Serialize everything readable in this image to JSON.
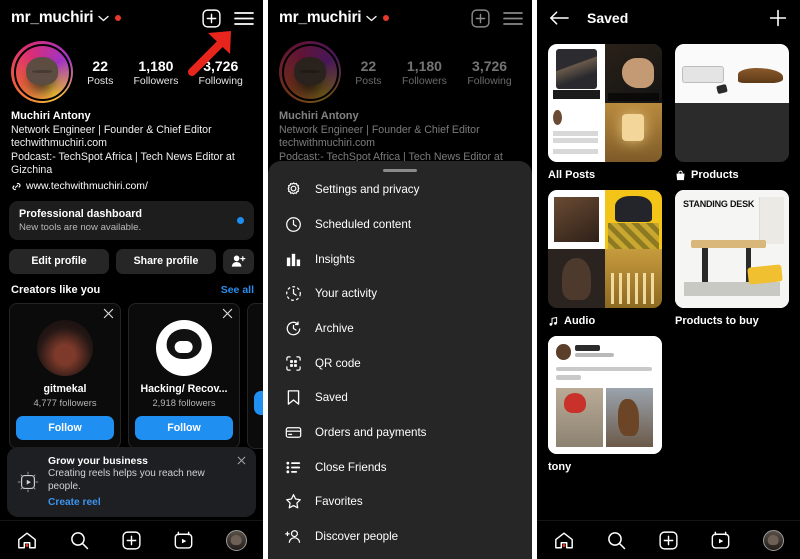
{
  "colors": {
    "accent_blue": "#1f8ff2",
    "link_blue": "#2d8ced",
    "arrow_red": "#e8251c",
    "notif_red": "#e8392a",
    "sheet_bg": "#262626",
    "panel_bg": "#000000"
  },
  "profile": {
    "username": "mr_muchiri",
    "stats": [
      {
        "value": "22",
        "label": "Posts"
      },
      {
        "value": "1,180",
        "label": "Followers"
      },
      {
        "value": "3,726",
        "label": "Following"
      }
    ],
    "display_name": "Muchiri Antony",
    "bio_lines": [
      "Network Engineer | Founder & Chief Editor",
      "techwithmuchiri.com",
      "Podcast:- TechSpot Africa | Tech News Editor at",
      "Gizchina"
    ],
    "bio_lines_panel2": [
      "Network Engineer | Founder & Chief Editor",
      "techwithmuchiri.com",
      "Podcast:- TechSpot Africa | Tech News Editor at"
    ],
    "link": "www.techwithmuchiri.com/",
    "dashboard": {
      "title": "Professional dashboard",
      "subtitle": "New tools are now available."
    },
    "buttons": {
      "edit": "Edit profile",
      "share": "Share profile"
    },
    "creators": {
      "title": "Creators like you",
      "see_all": "See all"
    },
    "creator_cards": [
      {
        "name": "gitmekal",
        "followers": "4,777 followers",
        "follow": "Follow"
      },
      {
        "name": "Hacking/ Recov...",
        "followers": "2,918 followers",
        "follow": "Follow"
      },
      {
        "name": "",
        "followers": "",
        "follow": ""
      }
    ],
    "toast": {
      "title": "Grow your business",
      "body": "Creating reels helps you reach new people.",
      "link": "Create reel"
    }
  },
  "menu": {
    "items": [
      {
        "icon": "gear-icon",
        "label": "Settings and privacy"
      },
      {
        "icon": "clock-icon",
        "label": "Scheduled content"
      },
      {
        "icon": "insights-bars-icon",
        "label": "Insights"
      },
      {
        "icon": "activity-clock-icon",
        "label": "Your activity"
      },
      {
        "icon": "archive-icon",
        "label": "Archive"
      },
      {
        "icon": "qr-code-icon",
        "label": "QR code"
      },
      {
        "icon": "bookmark-icon",
        "label": "Saved"
      },
      {
        "icon": "card-icon",
        "label": "Orders and payments"
      },
      {
        "icon": "list-icon",
        "label": "Close Friends"
      },
      {
        "icon": "star-icon",
        "label": "Favorites"
      },
      {
        "icon": "add-person-icon",
        "label": "Discover people"
      }
    ]
  },
  "saved": {
    "title": "Saved",
    "collections": [
      {
        "label": "All Posts",
        "icon": ""
      },
      {
        "label": "Products",
        "icon": "bag-icon"
      },
      {
        "label": "Audio",
        "icon": "music-note-icon"
      },
      {
        "label": "Products to buy",
        "icon": ""
      },
      {
        "label": "tony",
        "icon": ""
      }
    ],
    "standing_desk_label": "STANDING DESK"
  },
  "bottom_nav": [
    {
      "icon": "home-icon",
      "label": "Home"
    },
    {
      "icon": "search-icon",
      "label": "Search"
    },
    {
      "icon": "add-post-icon",
      "label": "Create"
    },
    {
      "icon": "reels-icon",
      "label": "Reels"
    },
    {
      "icon": "profile-avatar",
      "label": "Profile"
    }
  ],
  "annotations": [
    {
      "name": "arrow-to-menu",
      "target": "hamburger-menu"
    },
    {
      "name": "arrow-to-saved",
      "target": "menu-item-saved"
    },
    {
      "name": "arrow-to-all-posts",
      "target": "collection-all-posts"
    }
  ]
}
